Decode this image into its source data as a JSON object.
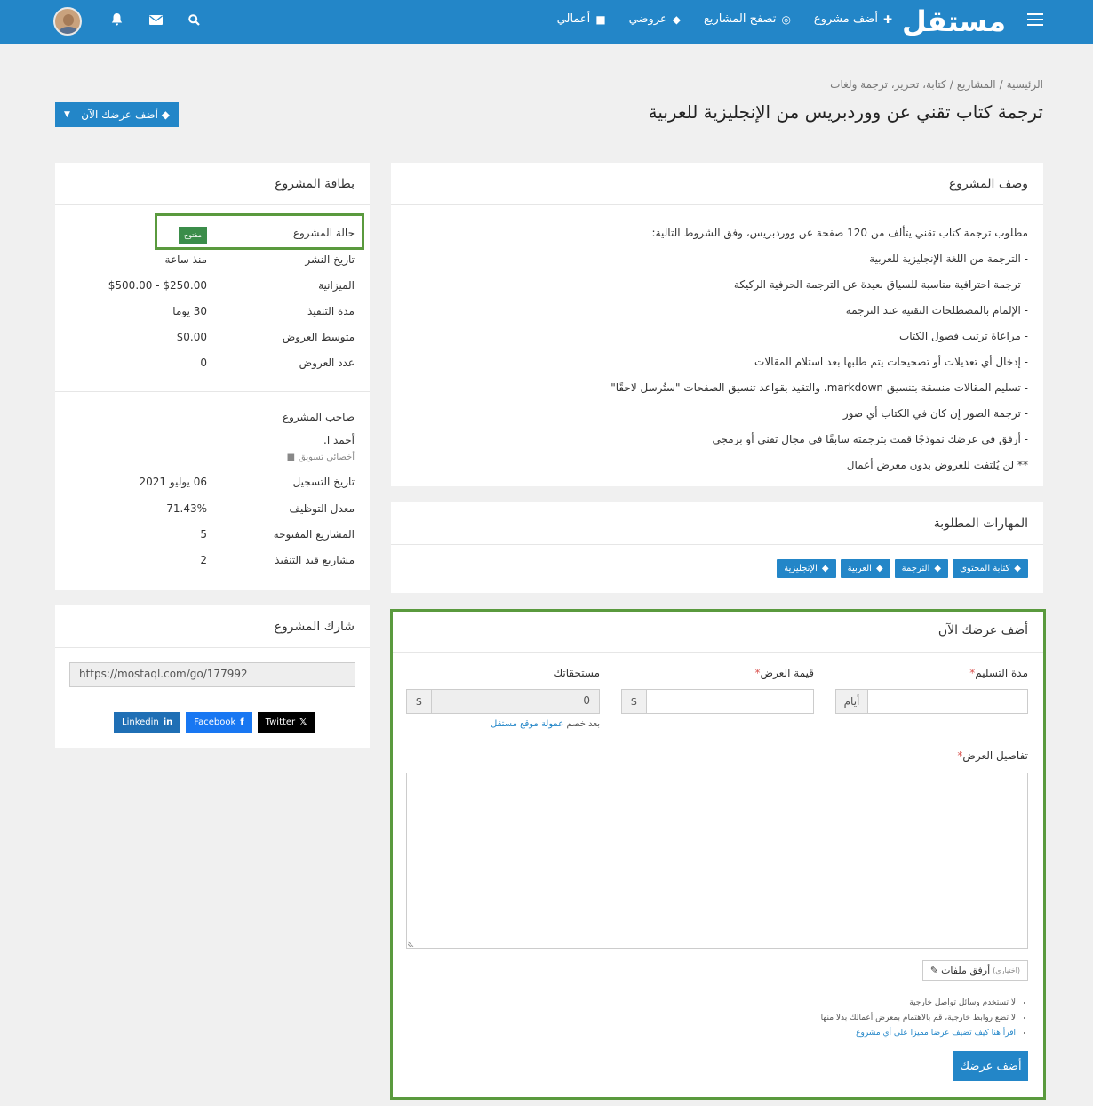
{
  "nav": {
    "logo": "مستقل",
    "links": [
      {
        "label": "أضف مشروع",
        "icon": "plus-icon"
      },
      {
        "label": "تصفح المشاريع",
        "icon": "binoculars-icon"
      },
      {
        "label": "عروضي",
        "icon": "tag-icon"
      },
      {
        "label": "أعمالي",
        "icon": "briefcase-icon"
      }
    ]
  },
  "breadcrumb": [
    "الرئيسية",
    "/",
    "المشاريع",
    "/",
    "كتابة، تحرير، ترجمة ولغات"
  ],
  "page_title": "ترجمة كتاب تقني عن ووردبريس من الإنجليزية للعربية",
  "add_offer_top": "أضف عرضك الآن",
  "description": {
    "heading": "وصف المشروع",
    "lines": [
      "مطلوب ترجمة كتاب تقني يتألف من 120 صفحة عن ووردبريس، وفق الشروط التالية:",
      "- الترجمة من اللغة الإنجليزية للعربية",
      "- ترجمة احترافية مناسبة للسياق بعيدة عن الترجمة الحرفية الركيكة",
      "- الإلمام بالمصطلحات التقنية عند الترجمة",
      "- مراعاة ترتيب فصول الكتاب",
      "- إدخال أي تعديلات أو تصحيحات يتم طلبها بعد استلام المقالات",
      "- تسليم المقالات منسقة بتنسيق markdown، والتقيد بقواعد تنسيق الصفحات \"ستُرسل لاحقًا\"",
      "- ترجمة الصور إن كان في الكتاب أي صور",
      "- أرفق في عرضك نموذجًا قمت بترجمته سابقًا في مجال تقني أو برمجي",
      "** لن يُلتفت للعروض بدون معرض أعمال"
    ]
  },
  "skills": {
    "heading": "المهارات المطلوبة",
    "tags": [
      "كتابة المحتوى",
      "الترجمة",
      "العربية",
      "الإنجليزية"
    ]
  },
  "offer_form": {
    "heading": "أضف عرضك الآن",
    "delivery_label": "مدة التسليم",
    "delivery_addon": "أيام",
    "price_label": "قيمة العرض",
    "price_addon": "$",
    "earnings_label": "مستحقاتك",
    "earnings_value": "0",
    "earnings_addon": "$",
    "fee_note_prefix": "بعد خصم",
    "fee_note_link": "عمولة موقع مستقل",
    "details_label": "تفاصيل العرض",
    "attach_label": "أرفق ملفات",
    "attach_optional": "(اختياري)",
    "rules": [
      {
        "text": "لا تستخدم وسائل تواصل خارجية",
        "link": ""
      },
      {
        "text": "لا تضع روابط خارجية، قم بالاهتمام بمعرض أعمالك بدلا منها",
        "link": ""
      },
      {
        "text": "",
        "link": "اقرأ هنا كيف تضيف عرضا مميزا على أي مشروع"
      }
    ],
    "submit_label": "أضف عرضك"
  },
  "project_card": {
    "heading": "بطاقة المشروع",
    "rows": [
      {
        "key": "حالة المشروع",
        "value": "مفتوح"
      },
      {
        "key": "تاريخ النشر",
        "value": "منذ ساعة"
      },
      {
        "key": "الميزانية",
        "value": "$250.00 - $500.00"
      },
      {
        "key": "مدة التنفيذ",
        "value": "30 يوما"
      },
      {
        "key": "متوسط العروض",
        "value": "$0.00"
      },
      {
        "key": "عدد العروض",
        "value": "0"
      }
    ],
    "owner_title": "صاحب المشروع",
    "owner_name": "أحمد ا.",
    "owner_role": "أخصائي تسويق",
    "owner_rows": [
      {
        "key": "تاريخ التسجيل",
        "value": "06 يوليو 2021"
      },
      {
        "key": "معدل التوظيف",
        "value": "71.43%"
      },
      {
        "key": "المشاريع المفتوحة",
        "value": "5"
      },
      {
        "key": "مشاريع قيد التنفيذ",
        "value": "2"
      }
    ]
  },
  "share": {
    "heading": "شارك المشروع",
    "url": "https://mostaql.com/go/177992",
    "linkedin": "Linkedin",
    "facebook": "Facebook",
    "twitter": "Twitter"
  }
}
